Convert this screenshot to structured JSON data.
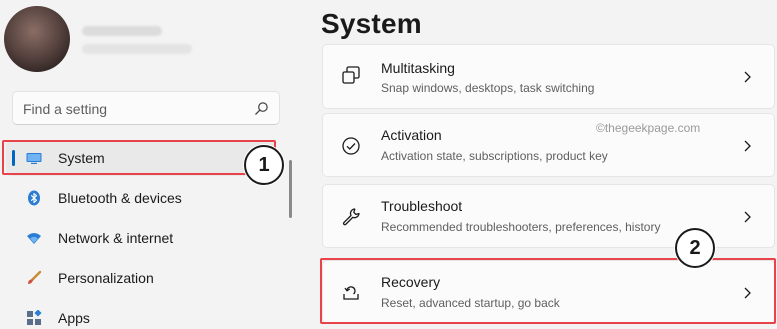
{
  "window": {
    "page_title": "System"
  },
  "search": {
    "placeholder": "Find a setting"
  },
  "nav": {
    "items": [
      {
        "label": "System",
        "icon": "monitor-icon"
      },
      {
        "label": "Bluetooth & devices",
        "icon": "bluetooth-icon"
      },
      {
        "label": "Network & internet",
        "icon": "wifi-icon"
      },
      {
        "label": "Personalization",
        "icon": "brush-icon"
      },
      {
        "label": "Apps",
        "icon": "apps-icon"
      }
    ]
  },
  "cards": [
    {
      "title": "Multitasking",
      "subtitle": "Snap windows, desktops, task switching",
      "icon": "multitasking-icon"
    },
    {
      "title": "Activation",
      "subtitle": "Activation state, subscriptions, product key",
      "icon": "activation-check-icon"
    },
    {
      "title": "Troubleshoot",
      "subtitle": "Recommended troubleshooters, preferences, history",
      "icon": "wrench-icon"
    },
    {
      "title": "Recovery",
      "subtitle": "Reset, advanced startup, go back",
      "icon": "recovery-icon"
    }
  ],
  "watermark": "©thegeekpage.com",
  "callouts": {
    "one": "1",
    "two": "2"
  },
  "colors": {
    "accent": "#0067c0",
    "highlight": "#e8424a",
    "background": "#f3f3f3"
  }
}
